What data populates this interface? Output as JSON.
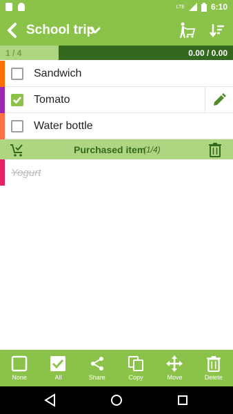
{
  "status_bar": {
    "time": "6:10",
    "network": "LTE"
  },
  "app_bar": {
    "title": "School trip"
  },
  "progress": {
    "count": "1 / 4",
    "total": "0.00 / 0.00",
    "fraction": 0.25
  },
  "items": [
    {
      "label": "Sandwich",
      "color": "#ff6f00",
      "checked": false
    },
    {
      "label": "Tomato",
      "color": "#9c27b0",
      "checked": true
    },
    {
      "label": "Water bottle",
      "color": "#ff7043",
      "checked": false
    }
  ],
  "section": {
    "title": "Purchased item",
    "count": "(1/4)"
  },
  "purchased": [
    {
      "label": "Yogurt",
      "color": "#e91e63"
    }
  ],
  "bottom_bar": {
    "none": "None",
    "all": "All",
    "share": "Share",
    "copy": "Copy",
    "move": "Move",
    "delete": "Delete"
  },
  "colors": {
    "accent": "#8bc34a",
    "dark": "#33691e",
    "light": "#aed581"
  }
}
